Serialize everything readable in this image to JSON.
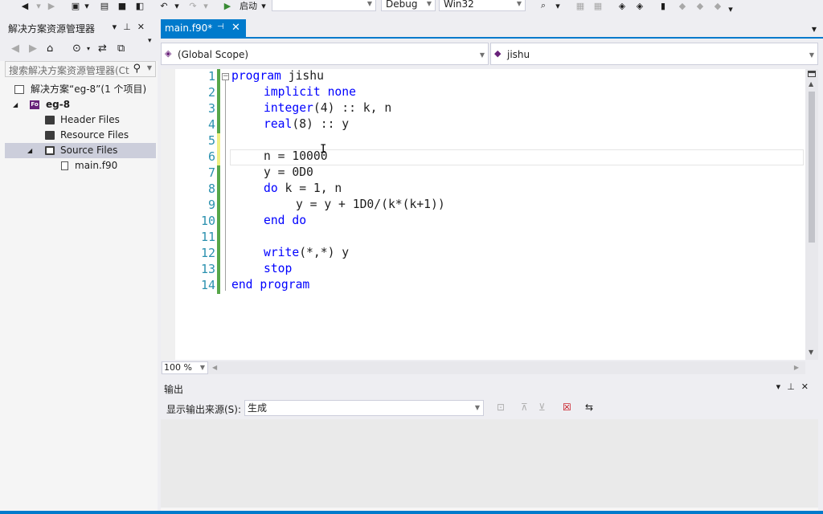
{
  "toolbar": {
    "start_label": "启动",
    "config_combo": "",
    "debug_label": "Debug",
    "platform_label": "Win32"
  },
  "solution_explorer": {
    "title": "解决方案资源管理器",
    "search_placeholder": "搜索解决方案资源管理器(Ct",
    "tree": {
      "solution": "解决方案“eg-8”(1 个项目)",
      "project": "eg-8",
      "project_badge": "Fo",
      "header_files": "Header Files",
      "resource_files": "Resource Files",
      "source_files": "Source Files",
      "main_file": "main.f90"
    }
  },
  "editor": {
    "tab_title": "main.f90*",
    "scope": "(Global Scope)",
    "member": "jishu",
    "zoom": "100 %",
    "line_numbers": [
      "1",
      "2",
      "3",
      "4",
      "5",
      "6",
      "7",
      "8",
      "9",
      "10",
      "11",
      "12",
      "13",
      "14"
    ],
    "code": {
      "l1_kw": "program",
      "l1_rest": " jishu",
      "l2_kw": "implicit none",
      "l3_kw": "integer",
      "l3_rest": "(4) :: k, n",
      "l4_kw": "real",
      "l4_rest": "(8) :: y",
      "l6": "n = 10000",
      "l7": "y = 0D0",
      "l8_kw": "do",
      "l8_rest": " k = 1, n",
      "l9": "y = y + 1D0/(k*(k+1))",
      "l10_kw": "end do",
      "l12_kw": "write",
      "l12_rest": "(*,*) y",
      "l13_kw": "stop",
      "l14_kw": "end program"
    }
  },
  "output": {
    "title": "输出",
    "source_label": "显示输出来源(S):",
    "source_value": "生成"
  },
  "colors": {
    "accent": "#007acc",
    "keyword": "#0000ff",
    "line_number": "#2b91af",
    "saved_change": "#57a64a",
    "unsaved_change": "#efef84"
  }
}
